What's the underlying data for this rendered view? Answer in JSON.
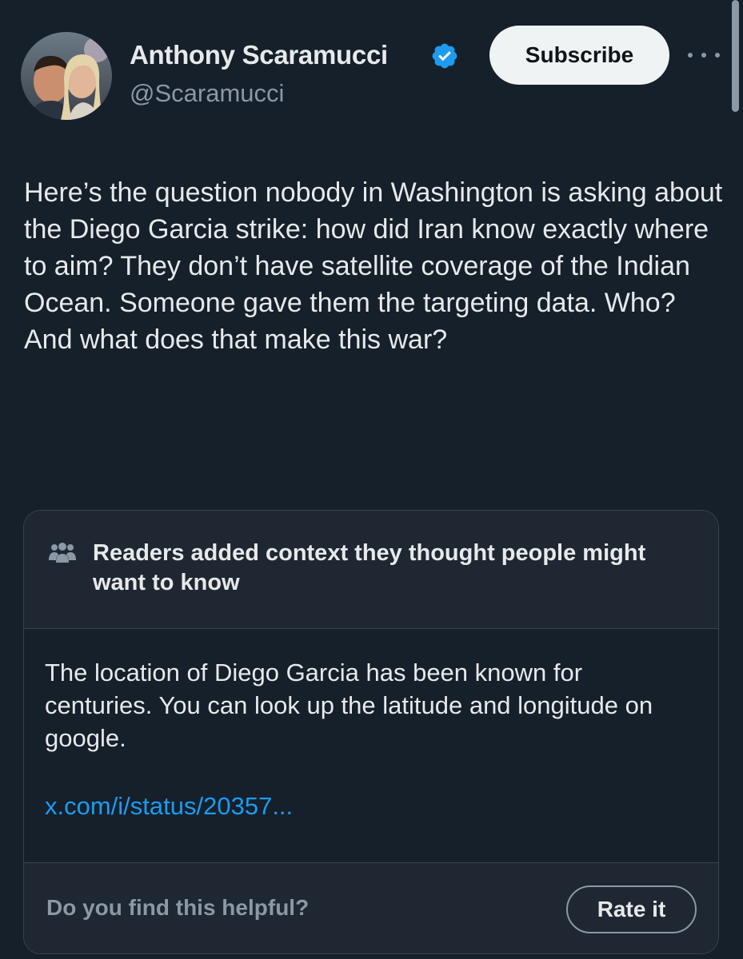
{
  "author": {
    "name": "Anthony Scaramucci",
    "handle": "@Scaramucci",
    "verified_icon": "verified-badge-icon",
    "avatar_icon": "profile-photo"
  },
  "actions": {
    "subscribe_label": "Subscribe",
    "more_icon": "more-dots-icon"
  },
  "tweet": {
    "text": "Here’s the question nobody in Washington is asking about the Diego Garcia strike: how did Iran know exactly where to aim? They don’t have satellite coverage of the Indian Ocean. Someone gave them the targeting data. Who? And what does that make this war?"
  },
  "community_note": {
    "icon": "people-icon",
    "title": "Readers added context they thought people might want to know",
    "body": "The location of Diego Garcia has been known for centuries. You can look up the latitude and longitude on google.",
    "link_text": "x.com/i/status/20357...",
    "helpful_question": "Do you find this helpful?",
    "rate_label": "Rate it"
  },
  "colors": {
    "background": "#15202b",
    "card": "#1e2732",
    "border": "#38444d",
    "text": "#e7e9ea",
    "secondary_text": "#8b98a5",
    "accent": "#1d9bf0"
  }
}
